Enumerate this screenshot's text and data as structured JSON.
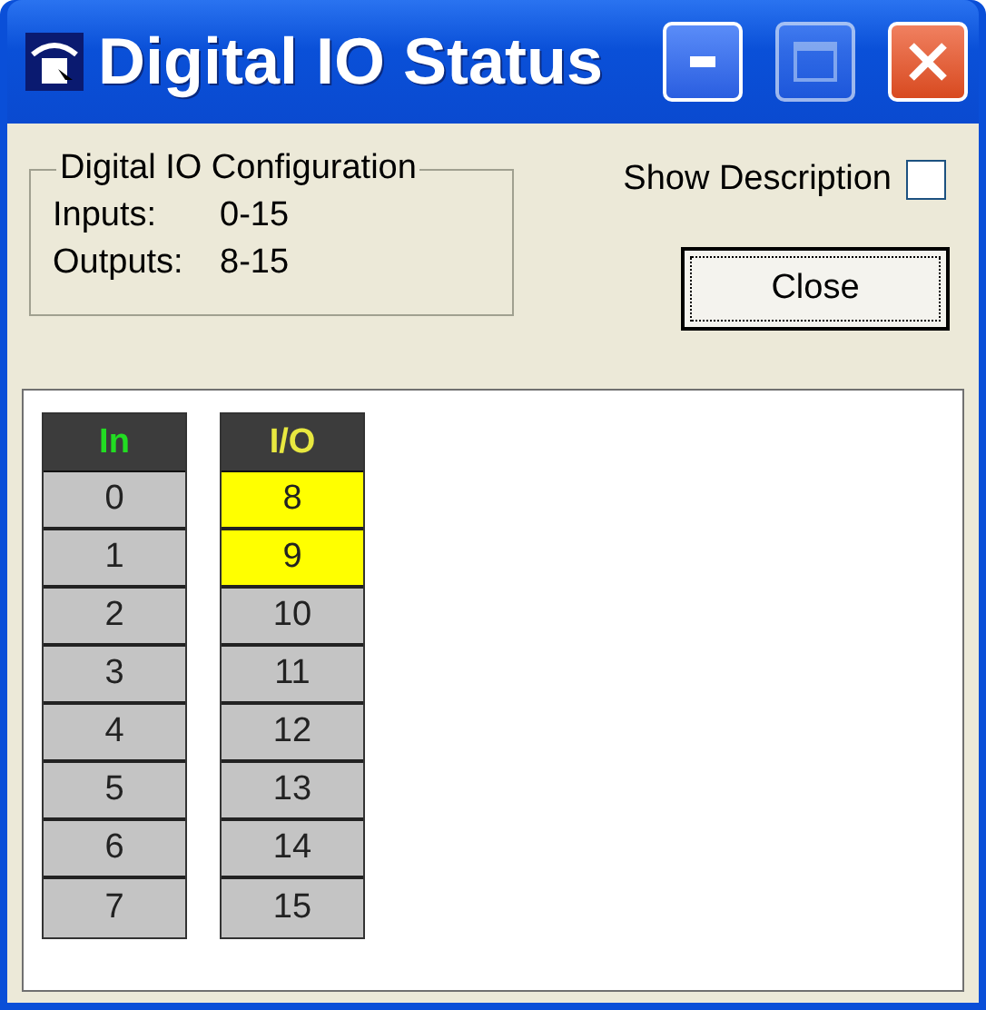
{
  "window": {
    "title": "Digital IO Status"
  },
  "configuration": {
    "title": "Digital IO Configuration",
    "rows": [
      {
        "label": "Inputs:",
        "value": "0-15"
      },
      {
        "label": "Outputs:",
        "value": "8-15"
      }
    ]
  },
  "show_description": {
    "label": "Show Description",
    "checked": false
  },
  "close_button": {
    "label": "Close"
  },
  "columns": [
    {
      "header": "In",
      "color": "#22dd22",
      "cells": [
        {
          "label": "0",
          "on": false
        },
        {
          "label": "1",
          "on": false
        },
        {
          "label": "2",
          "on": false
        },
        {
          "label": "3",
          "on": false
        },
        {
          "label": "4",
          "on": false
        },
        {
          "label": "5",
          "on": false
        },
        {
          "label": "6",
          "on": false
        },
        {
          "label": "7",
          "on": false
        }
      ]
    },
    {
      "header": "I/O",
      "color": "#e8e840",
      "cells": [
        {
          "label": "8",
          "on": true
        },
        {
          "label": "9",
          "on": true
        },
        {
          "label": "10",
          "on": false
        },
        {
          "label": "11",
          "on": false
        },
        {
          "label": "12",
          "on": false
        },
        {
          "label": "13",
          "on": false
        },
        {
          "label": "14",
          "on": false
        },
        {
          "label": "15",
          "on": false
        }
      ]
    }
  ]
}
